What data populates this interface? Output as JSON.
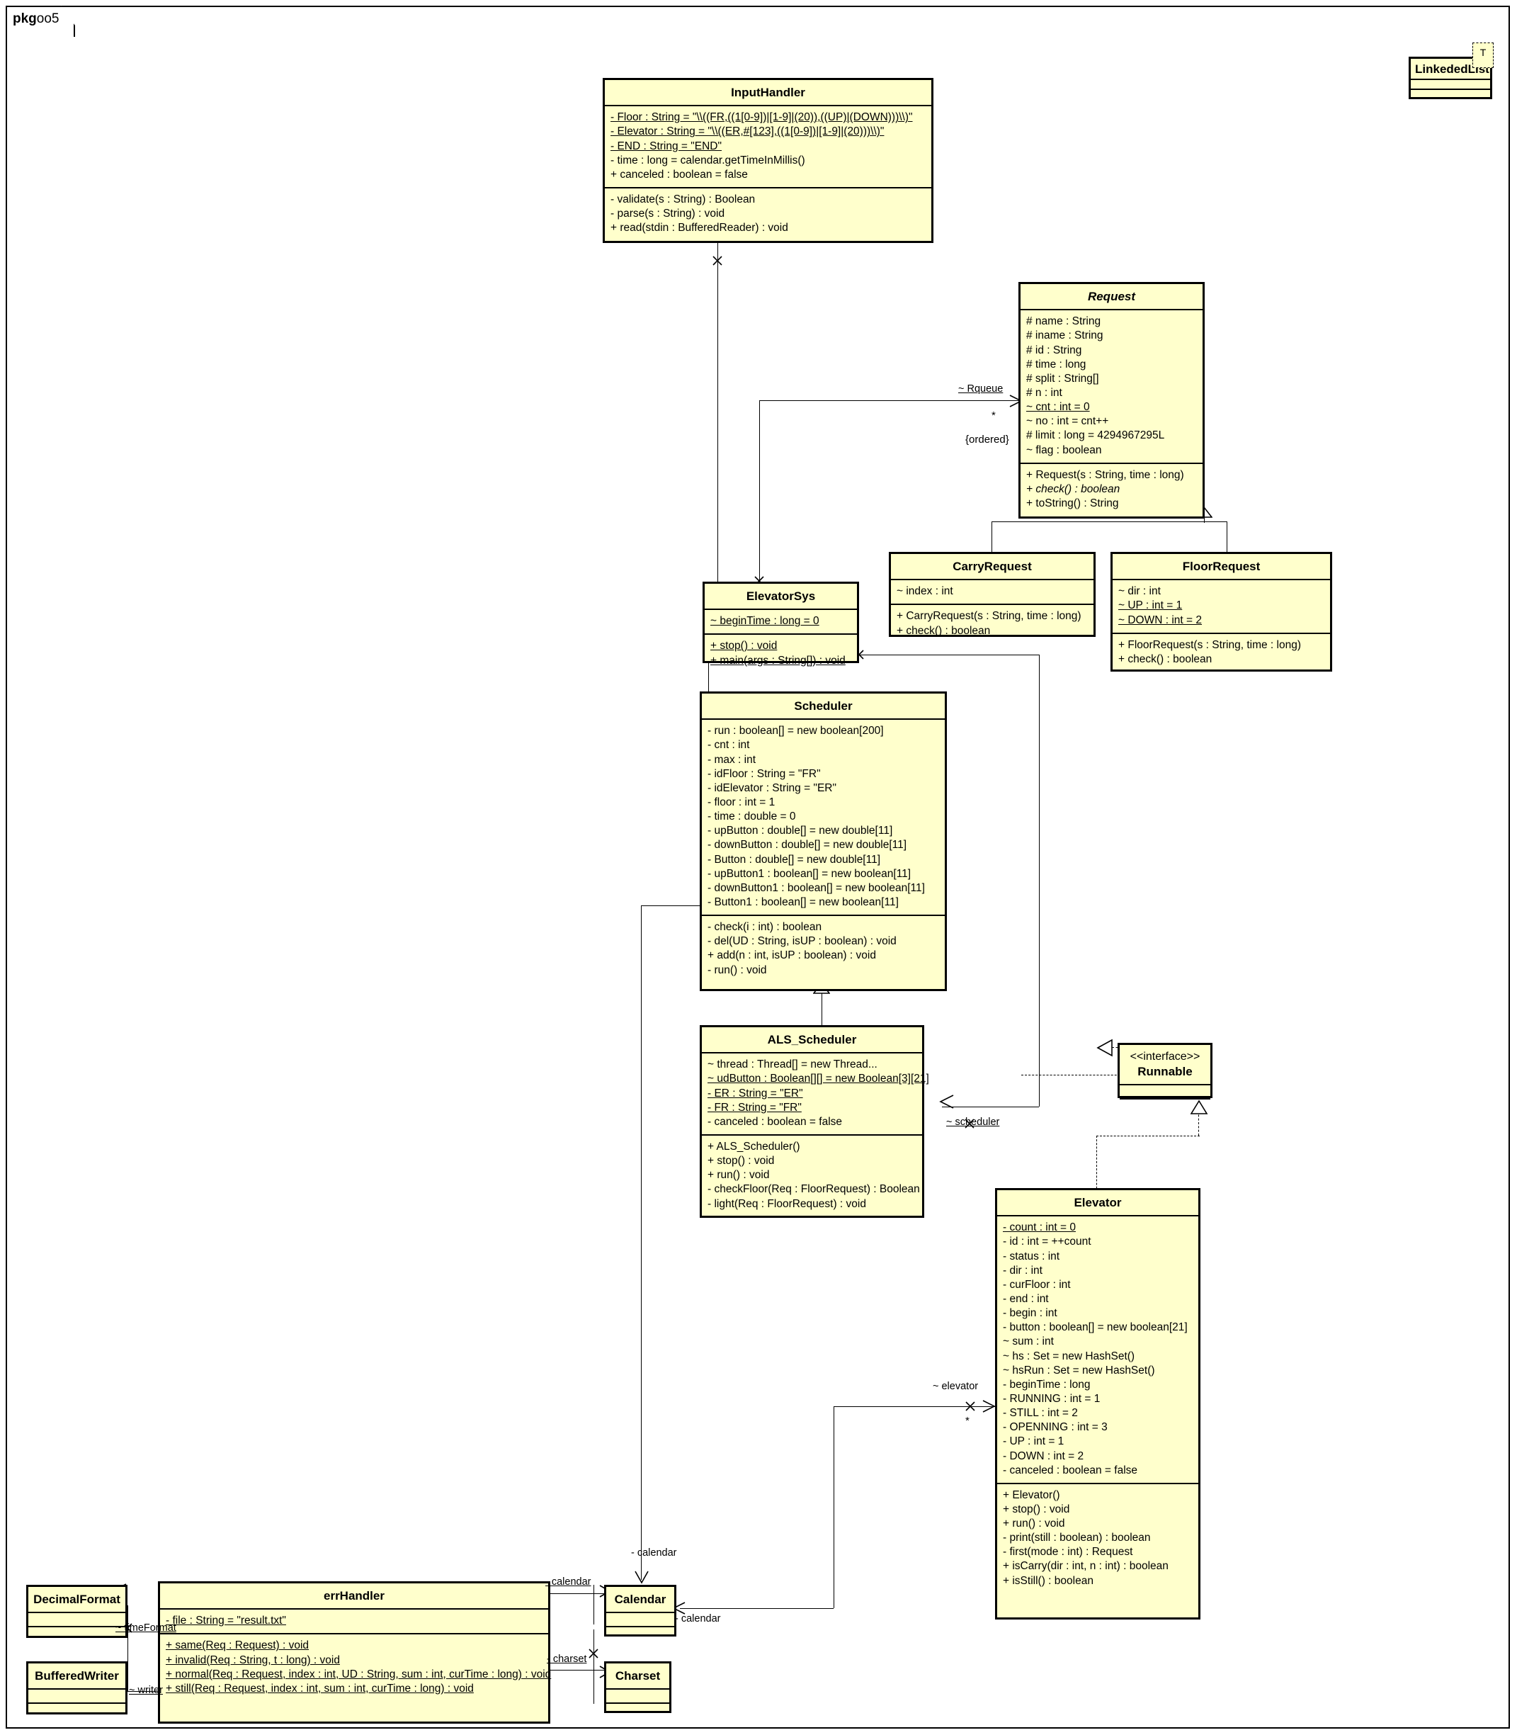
{
  "package": {
    "bold_prefix": "pkg",
    "name": "oo5"
  },
  "classes": {
    "input_handler": {
      "name": "InputHandler",
      "attributes": [
        "- Floor : String = \"\\\\((FR,((1[0-9])|[1-9]|(20)),((UP)|(DOWN)))\\\\)\"",
        "- Elevator : String = \"\\\\((ER,#[123],((1[0-9])|[1-9]|(20)))\\\\)\"",
        "- END : String = \"END\"",
        "- time : long = calendar.getTimeInMillis()",
        "+ canceled : boolean = false"
      ],
      "operations": [
        "- validate(s : String) : Boolean",
        "- parse(s : String) : void",
        "+ read(stdin : BufferedReader) : void"
      ]
    },
    "request": {
      "name": "Request",
      "attributes": [
        "# name : String",
        "# iname : String",
        "# id : String",
        "# time : long",
        "# split : String[]",
        "# n : int",
        "~ cnt : int = 0",
        "~ no : int = cnt++",
        "# limit : long = 4294967295L",
        "~ flag : boolean"
      ],
      "operations": [
        "+ Request(s : String, time : long)",
        "+ check() : boolean",
        "+ toString() : String"
      ]
    },
    "carry_request": {
      "name": "CarryRequest",
      "attributes": [
        "~ index : int"
      ],
      "operations": [
        "+ CarryRequest(s : String, time : long)",
        "+ check() : boolean"
      ]
    },
    "floor_request": {
      "name": "FloorRequest",
      "attributes": [
        "~ dir : int",
        "~ UP : int = 1",
        "~ DOWN : int = 2"
      ],
      "operations": [
        "+ FloorRequest(s : String, time : long)",
        "+ check() : boolean"
      ]
    },
    "elevator_sys": {
      "name": "ElevatorSys",
      "attributes": [
        "~ beginTime : long = 0"
      ],
      "operations": [
        "+ stop() : void",
        "+ main(args : String[]) : void"
      ]
    },
    "scheduler": {
      "name": "Scheduler",
      "attributes": [
        "- run : boolean[] = new boolean[200]",
        "- cnt : int",
        "- max : int",
        "- idFloor : String = \"FR\"",
        "- idElevator : String = \"ER\"",
        "- floor : int = 1",
        "- time : double = 0",
        "- upButton : double[] = new double[11]",
        "- downButton : double[] = new double[11]",
        "- Button : double[] = new double[11]",
        "- upButton1 : boolean[] = new boolean[11]",
        "- downButton1 : boolean[] = new boolean[11]",
        "- Button1 : boolean[] = new boolean[11]"
      ],
      "operations": [
        "- check(i : int) : boolean",
        "- del(UD : String, isUP : boolean) : void",
        "+ add(n : int, isUP : boolean) : void",
        "- run() : void"
      ]
    },
    "als_scheduler": {
      "name": "ALS_Scheduler",
      "attributes": [
        "~ thread : Thread[] = new Thread...",
        "~ udButton : Boolean[][] = new Boolean[3][21]",
        "- ER : String = \"ER\"",
        "- FR : String = \"FR\"",
        "- canceled : boolean = false"
      ],
      "operations": [
        "+ ALS_Scheduler()",
        "+ stop() : void",
        "+ run() : void",
        "- checkFloor(Req : FloorRequest) : Boolean",
        "- light(Req : FloorRequest) : void"
      ]
    },
    "runnable": {
      "stereotype": "<<interface>>",
      "name": "Runnable",
      "attributes": [],
      "operations": []
    },
    "elevator": {
      "name": "Elevator",
      "attributes": [
        "- count : int = 0",
        "- id : int = ++count",
        "- status : int",
        "- dir : int",
        "- curFloor : int",
        "- end : int",
        "- begin : int",
        "- button : boolean[] = new boolean[21]",
        "~ sum : int",
        "~ hs : Set = new HashSet()",
        "~ hsRun : Set = new HashSet()",
        "- beginTime : long",
        "- RUNNING : int = 1",
        "- STILL : int = 2",
        "- OPENNING : int = 3",
        "- UP : int = 1",
        "- DOWN : int = 2",
        "- canceled : boolean = false"
      ],
      "operations": [
        "+ Elevator()",
        "+ stop() : void",
        "+ run() : void",
        "- print(still : boolean) : boolean",
        "- first(mode : int) : Request",
        "+ isCarry(dir : int, n : int) : boolean",
        "+ isStill() : boolean"
      ]
    },
    "err_handler": {
      "name": "errHandler",
      "attributes": [
        "- file : String = \"result.txt\""
      ],
      "operations": [
        "+ same(Req : Request) : void",
        "+ invalid(Req : String, t : long) : void",
        "+ normal(Req : Request, index : int, UD : String, sum : int, curTime : long) : void",
        "+ still(Req : Request, index : int, sum : int, curTime : long) : void"
      ]
    },
    "decimal_format": {
      "name": "DecimalFormat",
      "attributes": [],
      "operations": []
    },
    "buffered_writer": {
      "name": "BufferedWriter",
      "attributes": [],
      "operations": []
    },
    "calendar": {
      "name": "Calendar",
      "attributes": [],
      "operations": []
    },
    "charset": {
      "name": "Charset",
      "attributes": [],
      "operations": []
    },
    "linkeded_list": {
      "name": "LinkededList",
      "template_param": "T",
      "attributes": [],
      "operations": []
    }
  },
  "edges": {
    "rqueue_label": "~ Rqueue",
    "rqueue_mult": "*",
    "rqueue_constraint": "{ordered}",
    "scheduler_label": "~ scheduler",
    "elevator_label": "~ elevator",
    "elevator_mult": "*",
    "calendar_label_top": "- calendar",
    "calendar_label_left": "- calendar",
    "calendar_label_right": "- calendar",
    "charset_label": "- charset",
    "time_format_label": "~ timeFormat",
    "writer_label": "~ writer"
  },
  "colors": {
    "box_fill": "#ffffcc",
    "box_border": "#000000",
    "canvas": "#ffffff",
    "text": "#000000"
  }
}
